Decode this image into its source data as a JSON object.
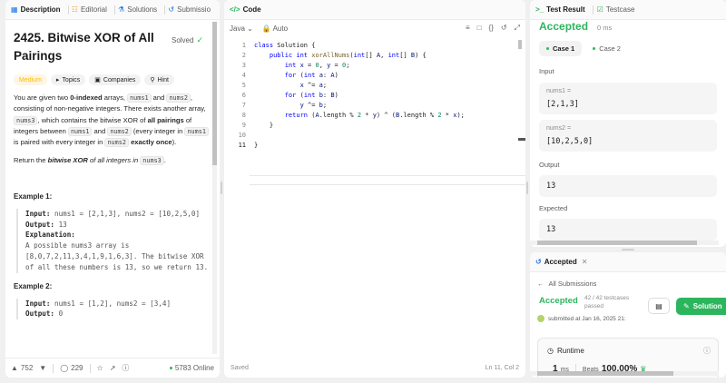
{
  "left": {
    "tabs": [
      {
        "label": "Description",
        "icon": "description-icon"
      },
      {
        "label": "Editorial",
        "icon": "editorial-icon"
      },
      {
        "label": "Solutions",
        "icon": "solutions-icon"
      },
      {
        "label": "Submissio",
        "icon": "submissions-icon"
      }
    ],
    "title": "2425. Bitwise XOR of All Pairings",
    "solved": "Solved",
    "tags": {
      "difficulty": "Medium",
      "topics": "Topics",
      "companies": "Companies",
      "hint": "Hint"
    },
    "desc": {
      "p1_a": "You are given two ",
      "p1_b": "0-indexed",
      "p1_c": " arrays, ",
      "p1_nums1": "nums1",
      "p1_d": " and ",
      "p1_nums2": "nums2",
      "p1_e": ", consisting of non-negative integers. There exists another array, ",
      "p1_nums3": "nums3",
      "p1_f": ", which contains the bitwise XOR of ",
      "p1_g": "all pairings",
      "p1_h": " of integers between ",
      "p1_nums1b": "nums1",
      "p1_i": " and ",
      "p1_nums2b": "nums2",
      "p1_j": " (every integer in ",
      "p1_nums1c": "nums1",
      "p1_k": " is paired with every integer in ",
      "p1_nums2c": "nums2",
      "p1_l": "exactly once",
      "p1_m": ").",
      "p2_a": "Return the ",
      "p2_b": "bitwise XOR",
      "p2_c": " of all integers in ",
      "p2_nums3": "nums3",
      "p2_d": "."
    },
    "example1": {
      "title": "Example 1:",
      "input_label": "Input:",
      "input_value": " nums1 = [2,1,3], nums2 = [10,2,5,0]",
      "output_label": "Output:",
      "output_value": " 13",
      "explanation_label": "Explanation:",
      "explanation": "A possible nums3 array is [8,0,7,2,11,3,4,1,9,1,6,3]. The bitwise XOR of all these numbers is 13, so we return 13."
    },
    "example2": {
      "title": "Example 2:",
      "input_label": "Input:",
      "input_value": " nums1 = [1,2], nums2 = [3,4]",
      "output_label": "Output:",
      "output_value": " 0"
    },
    "footer": {
      "likes": "752",
      "comments": "229",
      "online": "5783 Online"
    }
  },
  "middle": {
    "tab": "Code",
    "language": "Java",
    "mode": "Auto",
    "lines": [
      "1",
      "2",
      "3",
      "4",
      "5",
      "6",
      "7",
      "8",
      "9",
      "10",
      "11"
    ],
    "status": "Saved",
    "cursor": "Ln 11, Col 2"
  },
  "right_top": {
    "tabs": [
      {
        "label": "Test Result"
      },
      {
        "label": "Testcase"
      }
    ],
    "status": "Accepted",
    "runtime": "0 ms",
    "cases": [
      "Case 1",
      "Case 2"
    ],
    "input_label": "Input",
    "param1_name": "nums1 =",
    "param1_value": "[2,1,3]",
    "param2_name": "nums2 =",
    "param2_value": "[10,2,5,0]",
    "output_label": "Output",
    "output_value": "13",
    "expected_label": "Expected",
    "expected_value": "13"
  },
  "right_bottom": {
    "tab": "Accepted",
    "back": "All Submissions",
    "status": "Accepted",
    "testcases": "42 / 42 testcases passed",
    "submitted": "submitted at Jan 16, 2025 21:",
    "solution_btn": "Solution",
    "runtime_label": "Runtime",
    "runtime_value": "1",
    "runtime_unit": "ms",
    "beats_label": "Beats",
    "beats_value": "100.00%"
  }
}
